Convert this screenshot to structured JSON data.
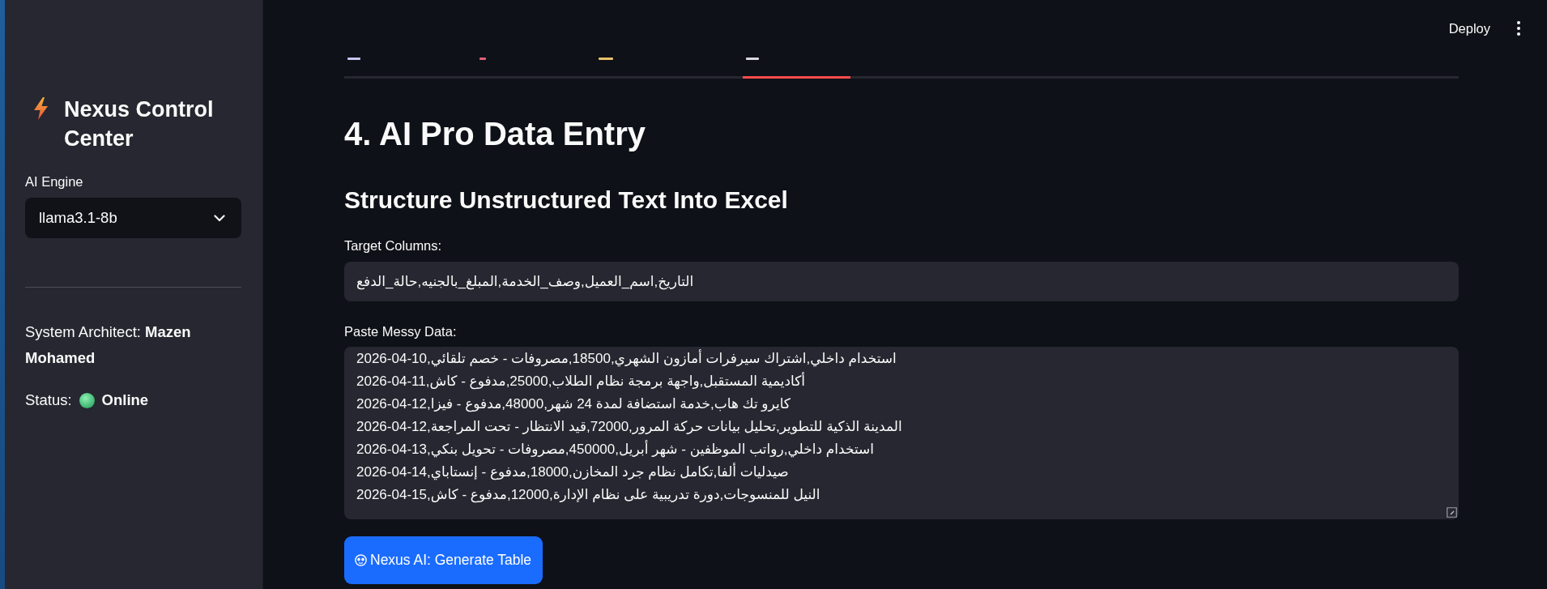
{
  "sidebar": {
    "title": "Nexus Control Center",
    "engine": {
      "label": "AI Engine",
      "value": "llama3.1-8b"
    },
    "architect": "System Architect: **Mazen Mohamed**",
    "status": {
      "label": "Status:",
      "value": "Online"
    }
  },
  "header": {
    "deploy": "Deploy"
  },
  "tabs": [
    {
      "selected": false
    },
    {
      "selected": false
    },
    {
      "selected": false
    },
    {
      "selected": true
    }
  ],
  "page": {
    "title": "4. AI Pro Data Entry",
    "subtitle": "Structure Unstructured Text Into Excel"
  },
  "target_columns": {
    "label": "Target Columns:",
    "value": "التاريخ,اسم_العميل,وصف_الخدمة,المبلغ_بالجنيه,حالة_الدفع"
  },
  "messy_data": {
    "label": "Paste Messy Data:",
    "lines": [
      "2026-04-10,استخدام داخلي,اشتراك سيرفرات أمازون الشهري,18500,مصروفات - خصم تلقائي",
      "2026-04-11,أكاديمية المستقبل,واجهة برمجة نظام الطلاب,25000,مدفوع - كاش",
      "2026-04-12,كايرو تك هاب,خدمة استضافة لمدة 24 شهر,48000,مدفوع - فيزا",
      "2026-04-12,المدينة الذكية للتطوير,تحليل بيانات حركة المرور,72000,قيد الانتظار - تحت المراجعة",
      "2026-04-13,استخدام داخلي,رواتب الموظفين - شهر أبريل,450000,مصروفات - تحويل بنكي",
      "2026-04-14,صيدليات ألفا,تكامل نظام جرد المخازن,18000,مدفوع - إنستاباي",
      "2026-04-15,النيل للمنسوجات,دورة تدريبية على نظام الإدارة,12000,مدفوع - كاش"
    ]
  },
  "generate_button": {
    "label": "Nexus AI: Generate Table"
  }
}
